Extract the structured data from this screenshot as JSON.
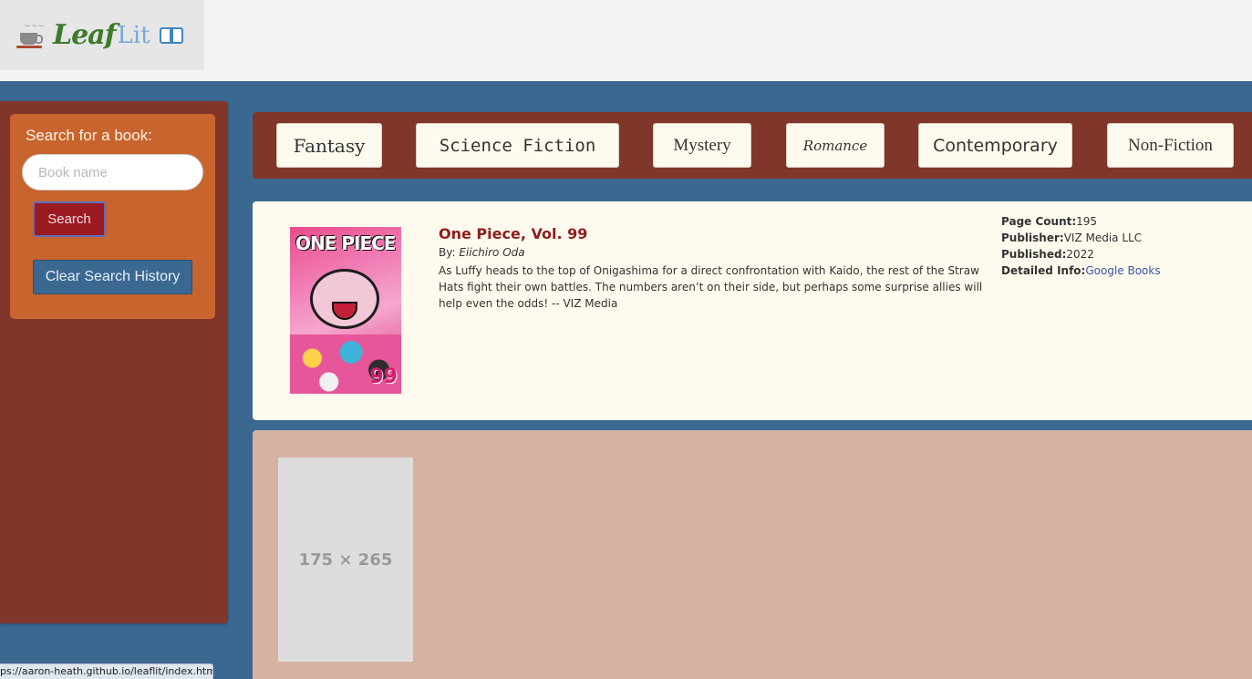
{
  "header": {
    "logo_part1": "Leaf",
    "logo_part2": "Lit",
    "cup_icon": "tea-cup-icon",
    "book_icon": "open-book-icon"
  },
  "sidebar": {
    "search_title": "Search for a book:",
    "search_placeholder": "Book name",
    "search_button": "Search",
    "clear_button": "Clear Search History"
  },
  "genres": [
    "Fantasy",
    "Science Fiction",
    "Mystery",
    "Romance",
    "Contemporary",
    "Non-Fiction"
  ],
  "book": {
    "title": "One Piece, Vol. 99",
    "by_label": "By: ",
    "author": "Eiichiro Oda",
    "description": "As Luffy heads to the top of Onigashima for a direct confrontation with Kaido, the rest of the Straw Hats fight their own battles. The numbers aren’t on their side, but perhaps some surprise allies will help even the odds! -- VIZ Media",
    "cover_title": "ONE PIECE",
    "cover_number": "99",
    "page_count_label": "Page Count:",
    "page_count": "195",
    "publisher_label": "Publisher:",
    "publisher": "VIZ Media LLC",
    "published_label": "Published:",
    "published": "2022",
    "detailed_label": "Detailed Info:",
    "detailed_link": "Google Books"
  },
  "placeholder_text": "175 × 265",
  "status_url": "ps://aaron-heath.github.io/leaflit/index.html",
  "colors": {
    "page_bg": "#3b6891",
    "sidebar_bg": "#80362a",
    "search_panel_bg": "#c8642e",
    "search_button_bg": "#9b1a22",
    "card_bg": "#fffaee",
    "second_card_bg": "#d6b2a1",
    "title_color": "#8f1d1d",
    "link_color": "#3756a5"
  }
}
